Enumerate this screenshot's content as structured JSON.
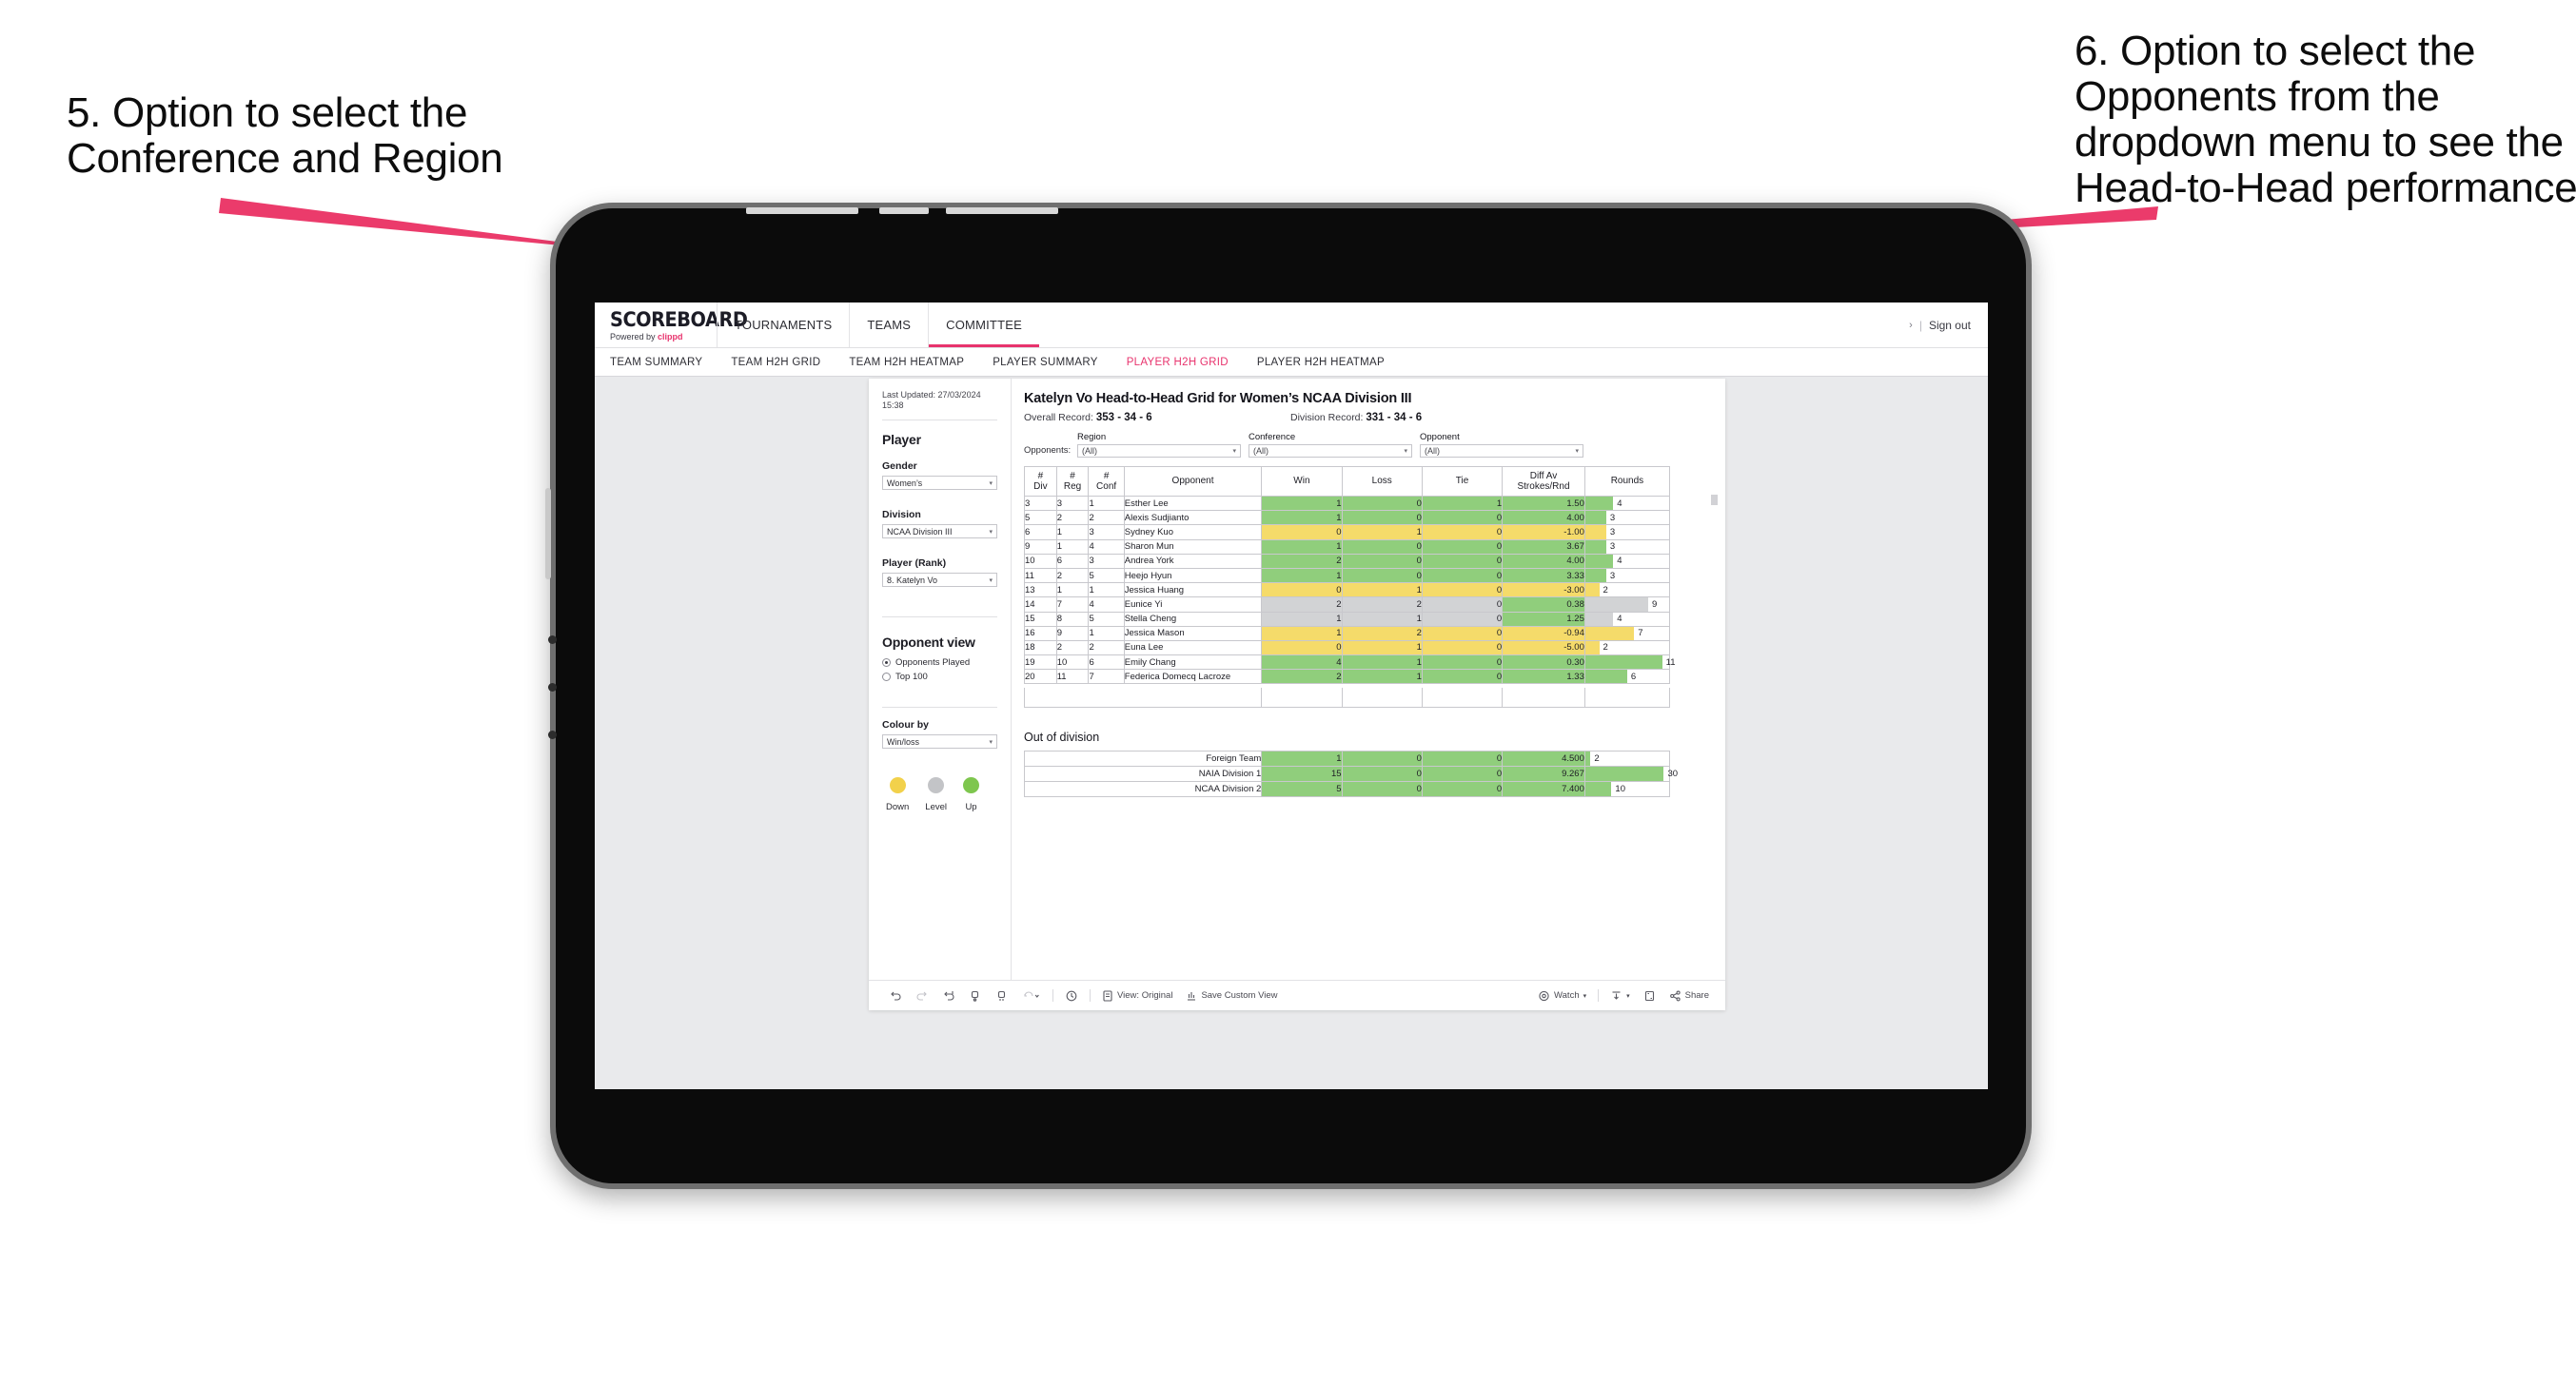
{
  "annotations": {
    "left": "5. Option to select the Conference and Region",
    "right": "6. Option to select the Opponents from the dropdown menu to see the Head-to-Head performance"
  },
  "header": {
    "brand_title": "SCOREBOARD",
    "brand_powered": "Powered by ",
    "brand_name": "clippd",
    "nav": [
      {
        "label": "TOURNAMENTS",
        "active": false
      },
      {
        "label": "TEAMS",
        "active": false
      },
      {
        "label": "COMMITTEE",
        "active": true
      }
    ],
    "account_caret": "›",
    "divider": "|",
    "sign_out": "Sign out"
  },
  "subnav": [
    {
      "label": "TEAM SUMMARY",
      "active": false
    },
    {
      "label": "TEAM H2H GRID",
      "active": false
    },
    {
      "label": "TEAM H2H HEATMAP",
      "active": false
    },
    {
      "label": "PLAYER SUMMARY",
      "active": false
    },
    {
      "label": "PLAYER H2H GRID",
      "active": true
    },
    {
      "label": "PLAYER H2H HEATMAP",
      "active": false
    }
  ],
  "sidebar": {
    "last_updated": "Last Updated: 27/03/2024 15:38",
    "player_section": "Player",
    "gender_label": "Gender",
    "gender_value": "Women’s",
    "division_label": "Division",
    "division_value": "NCAA Division III",
    "player_rank_label": "Player (Rank)",
    "player_rank_value": "8. Katelyn Vo",
    "opponent_view_title": "Opponent view",
    "opponent_view_options": [
      {
        "label": "Opponents Played",
        "selected": true
      },
      {
        "label": "Top 100",
        "selected": false
      }
    ],
    "colour_by_label": "Colour by",
    "colour_by_value": "Win/loss",
    "legend": [
      {
        "label": "Down",
        "color": "#F2D14B"
      },
      {
        "label": "Level",
        "color": "#C3C4C7"
      },
      {
        "label": "Up",
        "color": "#7EC64E"
      }
    ],
    "caret": "▾"
  },
  "main": {
    "title": "Katelyn Vo Head-to-Head Grid for Women’s NCAA Division III",
    "overall_record_label": "Overall Record: ",
    "overall_record_value": "353 -  34 - 6",
    "division_record_label": "Division Record: ",
    "division_record_value": "331 -  34 - 6",
    "filters_lead": "Opponents:",
    "filters": [
      {
        "label": "Region",
        "value": "(All)"
      },
      {
        "label": "Conference",
        "value": "(All)"
      },
      {
        "label": "Opponent",
        "value": "(All)"
      }
    ],
    "caret": "▾",
    "out_of_division_title": "Out of division"
  },
  "chart_data": {
    "type": "table",
    "title": "Katelyn Vo Head-to-Head Grid for Women’s NCAA Division III",
    "colors": {
      "up": "#90CE7C",
      "down": "#F5DB6A",
      "level": "#D2D3D5",
      "bar_max_rounds": 12
    },
    "columns": [
      "# Div",
      "# Reg",
      "# Conf",
      "Opponent",
      "Win",
      "Loss",
      "Tie",
      "Diff Av Strokes/Rnd",
      "Rounds"
    ],
    "header_lines": [
      [
        "#",
        "Div"
      ],
      [
        "#",
        "Reg"
      ],
      [
        "#",
        "Conf"
      ],
      [
        "Opponent"
      ],
      [
        "Win"
      ],
      [
        "Loss"
      ],
      [
        "Tie"
      ],
      [
        "Diff Av",
        "Strokes/Rnd"
      ],
      [
        "Rounds"
      ]
    ],
    "rows": [
      {
        "div": "3",
        "reg": "3",
        "conf": "1",
        "opponent": "Esther Lee",
        "win": "1",
        "loss": "0",
        "tie": "1",
        "diff": "1.50",
        "rounds": "4",
        "rounds_n": 4,
        "color": "up"
      },
      {
        "div": "5",
        "reg": "2",
        "conf": "2",
        "opponent": "Alexis Sudjianto",
        "win": "1",
        "loss": "0",
        "tie": "0",
        "diff": "4.00",
        "rounds": "3",
        "rounds_n": 3,
        "color": "up"
      },
      {
        "div": "6",
        "reg": "1",
        "conf": "3",
        "opponent": "Sydney Kuo",
        "win": "0",
        "loss": "1",
        "tie": "0",
        "diff": "-1.00",
        "rounds": "3",
        "rounds_n": 3,
        "color": "down"
      },
      {
        "div": "9",
        "reg": "1",
        "conf": "4",
        "opponent": "Sharon Mun",
        "win": "1",
        "loss": "0",
        "tie": "0",
        "diff": "3.67",
        "rounds": "3",
        "rounds_n": 3,
        "color": "up"
      },
      {
        "div": "10",
        "reg": "6",
        "conf": "3",
        "opponent": "Andrea York",
        "win": "2",
        "loss": "0",
        "tie": "0",
        "diff": "4.00",
        "rounds": "4",
        "rounds_n": 4,
        "color": "up"
      },
      {
        "div": "11",
        "reg": "2",
        "conf": "5",
        "opponent": "Heejo Hyun",
        "win": "1",
        "loss": "0",
        "tie": "0",
        "diff": "3.33",
        "rounds": "3",
        "rounds_n": 3,
        "color": "up"
      },
      {
        "div": "13",
        "reg": "1",
        "conf": "1",
        "opponent": "Jessica Huang",
        "win": "0",
        "loss": "1",
        "tie": "0",
        "diff": "-3.00",
        "rounds": "2",
        "rounds_n": 2,
        "color": "down"
      },
      {
        "div": "14",
        "reg": "7",
        "conf": "4",
        "opponent": "Eunice Yi",
        "win": "2",
        "loss": "2",
        "tie": "0",
        "diff": "0.38",
        "rounds": "9",
        "rounds_n": 9,
        "color": "level",
        "diff_color": "up"
      },
      {
        "div": "15",
        "reg": "8",
        "conf": "5",
        "opponent": "Stella Cheng",
        "win": "1",
        "loss": "1",
        "tie": "0",
        "diff": "1.25",
        "rounds": "4",
        "rounds_n": 4,
        "color": "level",
        "diff_color": "up"
      },
      {
        "div": "16",
        "reg": "9",
        "conf": "1",
        "opponent": "Jessica Mason",
        "win": "1",
        "loss": "2",
        "tie": "0",
        "diff": "-0.94",
        "rounds": "7",
        "rounds_n": 7,
        "color": "down"
      },
      {
        "div": "18",
        "reg": "2",
        "conf": "2",
        "opponent": "Euna Lee",
        "win": "0",
        "loss": "1",
        "tie": "0",
        "diff": "-5.00",
        "rounds": "2",
        "rounds_n": 2,
        "color": "down"
      },
      {
        "div": "19",
        "reg": "10",
        "conf": "6",
        "opponent": "Emily Chang",
        "win": "4",
        "loss": "1",
        "tie": "0",
        "diff": "0.30",
        "rounds": "11",
        "rounds_n": 11,
        "color": "up"
      },
      {
        "div": "20",
        "reg": "11",
        "conf": "7",
        "opponent": "Federica Domecq Lacroze",
        "win": "2",
        "loss": "1",
        "tie": "0",
        "diff": "1.33",
        "rounds": "6",
        "rounds_n": 6,
        "color": "up"
      }
    ],
    "out_of_division": [
      {
        "name": "Foreign Team",
        "win": "1",
        "loss": "0",
        "tie": "0",
        "diff": "4.500",
        "rounds": "2",
        "rounds_n": 2,
        "color": "up"
      },
      {
        "name": "NAIA Division 1",
        "win": "15",
        "loss": "0",
        "tie": "0",
        "diff": "9.267",
        "rounds": "30",
        "rounds_n": 30,
        "color": "up"
      },
      {
        "name": "NCAA Division 2",
        "win": "5",
        "loss": "0",
        "tie": "0",
        "diff": "7.400",
        "rounds": "10",
        "rounds_n": 10,
        "color": "up"
      }
    ],
    "out_of_division_bar_max": 32
  },
  "toolbar": {
    "view_original": "View: Original",
    "save_custom_view": "Save Custom View",
    "watch": "Watch",
    "share": "Share",
    "caret": "▾"
  }
}
